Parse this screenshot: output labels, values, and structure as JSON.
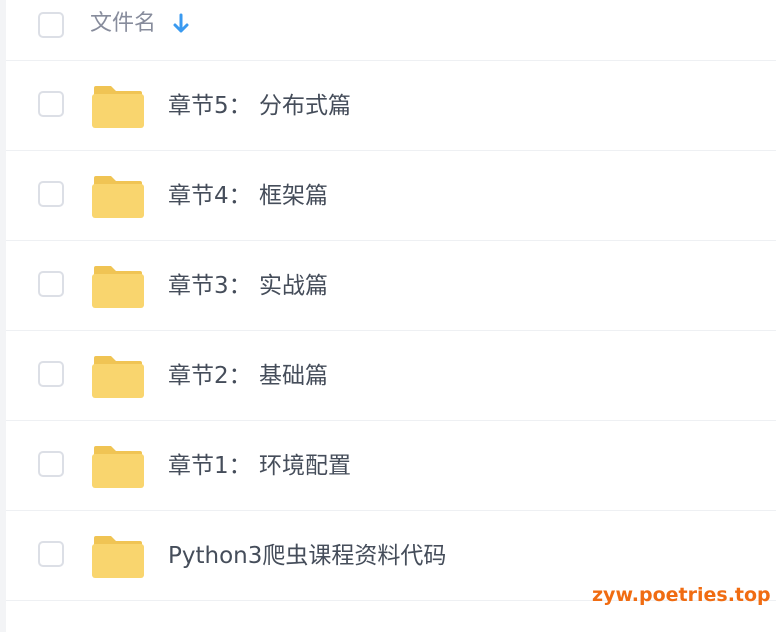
{
  "header": {
    "column_label": "文件名",
    "sort_icon": "arrow-down-icon"
  },
  "files": [
    {
      "name": "章节5：  分布式篇",
      "icon": "folder-icon"
    },
    {
      "name": "章节4：  框架篇",
      "icon": "folder-icon"
    },
    {
      "name": "章节3：  实战篇",
      "icon": "folder-icon"
    },
    {
      "name": "章节2：  基础篇",
      "icon": "folder-icon"
    },
    {
      "name": "章节1：  环境配置",
      "icon": "folder-icon"
    },
    {
      "name": "Python3爬虫课程资料代码",
      "icon": "folder-icon"
    }
  ],
  "watermark": "zyw.poetries.top",
  "colors": {
    "folder": "#f9d56e",
    "folder_tab": "#f0c454",
    "accent": "#3a9af0",
    "watermark": "#f06c12",
    "text": "#454d5a"
  }
}
